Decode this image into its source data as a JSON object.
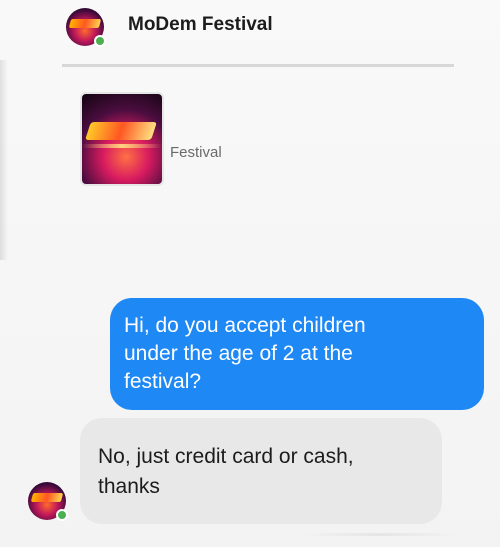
{
  "header": {
    "title": "MoDem Festival"
  },
  "page_card": {
    "subtitle": "Festival"
  },
  "messages": [
    {
      "from": "user",
      "text": "Hi, do you accept children\nunder the age of 2 at the\nfestival?"
    },
    {
      "from": "page",
      "text": "No, just credit card or cash,\nthanks"
    }
  ],
  "colors": {
    "outgoing_bubble": "#1e88f5",
    "incoming_bubble": "#e8e8e8",
    "online_dot": "#4caf50"
  }
}
